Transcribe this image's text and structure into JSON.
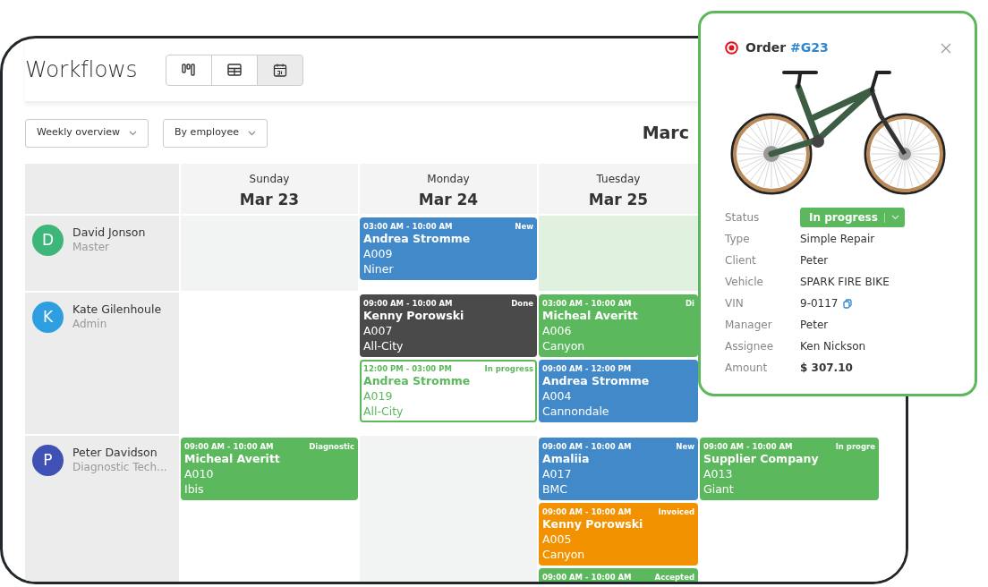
{
  "app": {
    "title": "Workflows",
    "views": [
      {
        "selected": false
      },
      {
        "selected": false
      },
      {
        "selected": true
      }
    ],
    "filters": [
      {
        "label": "Weekly overview"
      },
      {
        "label": "By employee"
      }
    ],
    "period": "Marc"
  },
  "calendar": {
    "days": [
      {
        "weekday": "Sunday",
        "date": "Mar 23"
      },
      {
        "weekday": "Monday",
        "date": "Mar 24"
      },
      {
        "weekday": "Tuesday",
        "date": "Mar 25"
      }
    ],
    "rows": [
      {
        "employee": {
          "initial": "D",
          "name": "David Jonson",
          "role": "Master",
          "color": "#3db67a"
        },
        "cells": [
          {
            "kind": "off"
          },
          {
            "cards": [
              {
                "kind": "blue",
                "time": "03:00 AM - 10:00 AM",
                "status": "New",
                "customer": "Andrea Stromme",
                "code": "A009",
                "brand": "Niner"
              }
            ]
          },
          {
            "kind": "selected"
          }
        ]
      },
      {
        "employee": {
          "initial": "K",
          "name": "Kate Gilenhoule",
          "role": "Admin",
          "color": "#2d9fe0"
        },
        "cells": [
          {},
          {
            "cards": [
              {
                "kind": "dark",
                "time": "09:00 AM - 10:00 AM",
                "status": "Done",
                "customer": "Kenny Porowski",
                "code": "A007",
                "brand": "All-City"
              },
              {
                "kind": "outline",
                "time": "12:00 PM - 03:00 PM",
                "status": "In progress",
                "customer": "Andrea Stromme",
                "code": "A019",
                "brand": "All-City"
              }
            ]
          },
          {
            "cards": [
              {
                "kind": "green",
                "time": "03:00 AM - 10:00 AM",
                "status": "Di",
                "customer": "Micheal Averitt",
                "code": "A006",
                "brand": "Canyon"
              },
              {
                "kind": "blue",
                "time": "09:00 AM - 12:00 PM",
                "customer": "Andrea Stromme",
                "code": "A004",
                "brand": "Cannondale"
              }
            ]
          }
        ]
      },
      {
        "employee": {
          "initial": "P",
          "name": "Peter Davidson",
          "role": "Diagnostic Tech...",
          "color": "#3f51b5"
        },
        "cells": [
          {
            "cards": [
              {
                "kind": "green",
                "time": "09:00 AM - 10:00 AM",
                "status": "Diagnostic",
                "customer": "Micheal Averitt",
                "code": "A010",
                "brand": "Ibis"
              }
            ]
          },
          {
            "kind": "off"
          },
          {
            "cards": [
              {
                "kind": "blue",
                "time": "09:00 AM - 10:00 AM",
                "status": "New",
                "customer": "Amaliia",
                "code": "A017",
                "brand": "BMC"
              },
              {
                "kind": "orange",
                "time": "09:00 AM - 10:00 AM",
                "status": "Invoiced",
                "customer": "Kenny Porowski",
                "code": "A005",
                "brand": "Canyon"
              },
              {
                "kind": "green",
                "time": "09:00 AM - 10:00 AM",
                "status": "Accepted"
              }
            ]
          },
          {
            "cards": [
              {
                "kind": "green",
                "time": "09:00 AM - 10:00 AM",
                "status": "In progre",
                "customer": "Supplier Company",
                "code": "A013",
                "brand": "Giant"
              }
            ]
          }
        ]
      }
    ]
  },
  "order_popup": {
    "title": "Order",
    "number": "#G23",
    "fields": [
      {
        "kind": "status",
        "label": "Status",
        "value": "In progress"
      },
      {
        "kind": "text",
        "label": "Type",
        "value": "Simple Repair"
      },
      {
        "kind": "text",
        "label": "Client",
        "value": "Peter"
      },
      {
        "kind": "text",
        "label": "Vehicle",
        "value": "SPARK FIRE BIKE"
      },
      {
        "kind": "copy",
        "label": "VIN",
        "value": "9-0117"
      },
      {
        "kind": "text",
        "label": "Manager",
        "value": "Peter"
      },
      {
        "kind": "text",
        "label": "Assignee",
        "value": "Ken Nickson"
      },
      {
        "kind": "bold",
        "label": "Amount",
        "value": "$ 307.10"
      }
    ]
  }
}
